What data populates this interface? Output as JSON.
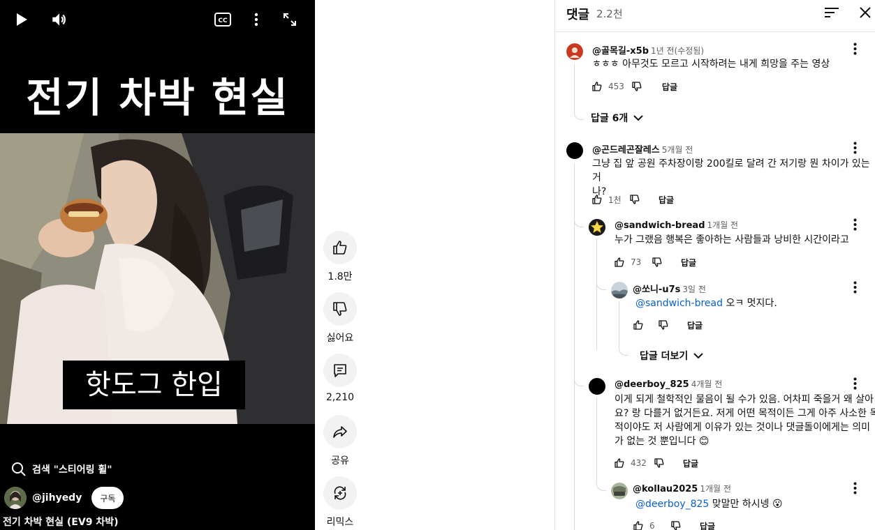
{
  "player": {
    "overlay_title": "전기 차박 현실",
    "caption": "핫도그 한입",
    "search_hint": "검색 \"스티어링 휠\"",
    "channel": "@jihyedy",
    "subscribe_label": "구독",
    "video_title": "전기 차박 현실 (EV9 차박)",
    "cc_label": "CC"
  },
  "actions": {
    "like_count": "1.8만",
    "dislike_label": "싫어요",
    "comment_count": "2,210",
    "share_label": "공유",
    "remix_label": "리믹스"
  },
  "comments_panel": {
    "title": "댓글",
    "count": "2.2천"
  },
  "comments": [
    {
      "author": "@골목길-x5b",
      "time": "1년 전(수정됨)",
      "text": "ㅎㅎㅎ 아무것도 모르고 시작하려는 내게 희망을 주는 영상",
      "likes": "453",
      "reply_label": "답글",
      "more_replies": "답글 6개",
      "avatar_color": "#c9381f"
    },
    {
      "author": "@곤드레곤잘레스",
      "time": "5개월 전",
      "text_line1": "그냥 집 앞 공원 주차장이랑 200킬로 달려 간 저기랑 뭔 차이가 있는거",
      "text_line2": "나?",
      "likes": "1천",
      "reply_label": "답글",
      "avatar_color": "#000000"
    },
    {
      "author": "@sandwich-bread",
      "time": "1개월 전",
      "text": "누가 그랬음 행복은 좋아하는 사람들과 낭비한 시간이라고",
      "likes": "73",
      "reply_label": "답글",
      "avatar_color": "#1a1a1a"
    },
    {
      "author": "@쏘니-u7s",
      "time": "3일 전",
      "mention": "@sandwich-bread",
      "text": " 오ㅋ 멋지다.",
      "likes": "",
      "reply_label": "답글",
      "more_replies": "답글 더보기",
      "avatar_color": "#9fb0bd"
    },
    {
      "author": "@deerboy_825",
      "time": "4개월 전",
      "text_line1": "이게 되게 철학적인 물음이 될 수가 있음. 어차피 죽을거 왜 살아",
      "text_line2": "요? 랑 다를거 없거든요. 저게 어떤 목적이든 그게 아주 사소한 목",
      "text_line3": "적이야도 저 사람에게 이유가 있는 것이나 댓글돌이에게는 의미",
      "text_line4": "가 없는 것 뿐입니다 😊",
      "likes": "432",
      "reply_label": "답글",
      "avatar_color": "#000000"
    },
    {
      "author": "@kollau2025",
      "time": "1개월 전",
      "mention": "@deerboy_825",
      "text": " 맞말만 하시넹 😮",
      "likes": "6",
      "reply_label": "답글",
      "avatar_color": "#8d9a7a"
    }
  ]
}
